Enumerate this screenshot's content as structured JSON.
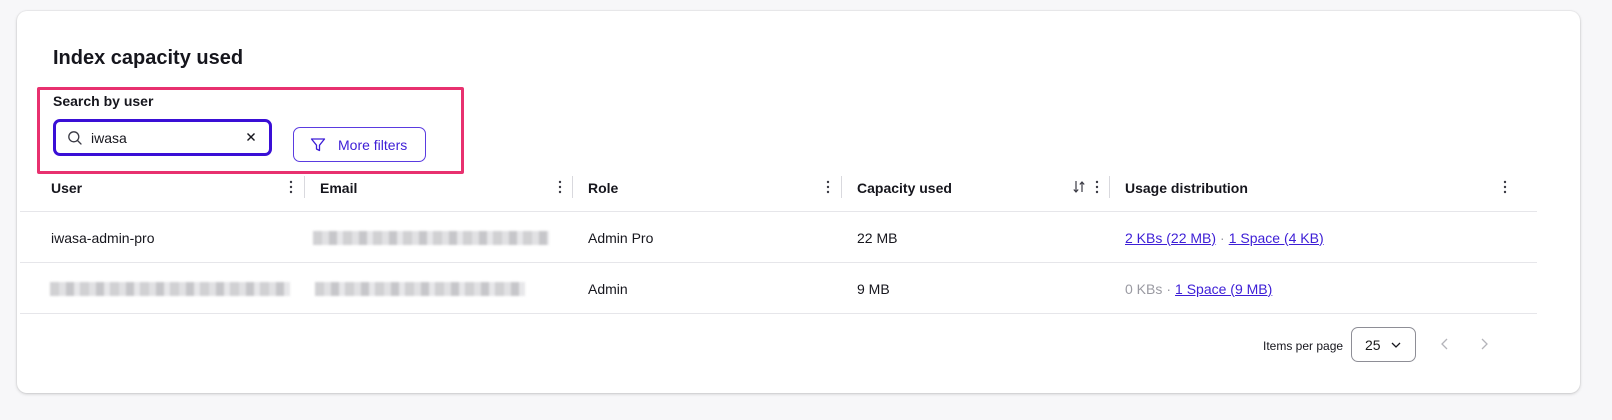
{
  "title": "Index capacity used",
  "search": {
    "label": "Search by user",
    "value": "iwasa",
    "placeholder": ""
  },
  "more_filters_label": "More filters",
  "columns": {
    "user": "User",
    "email": "Email",
    "role": "Role",
    "capacity": "Capacity used",
    "usage": "Usage distribution"
  },
  "rows": [
    {
      "user": "iwasa-admin-pro",
      "role": "Admin Pro",
      "capacity": "22 MB",
      "kbs": "2 KBs (22 MB)",
      "space": "1 Space (4 KB)"
    },
    {
      "user": "",
      "role": "Admin",
      "capacity": "9 MB",
      "kbs": "0 KBs",
      "space": "1 Space (9 MB)"
    }
  ],
  "footer": {
    "items_per_page_label": "Items per page",
    "items_per_page": "25"
  },
  "colors": {
    "accent": "#3d1ed6",
    "highlight": "#e8316f"
  }
}
